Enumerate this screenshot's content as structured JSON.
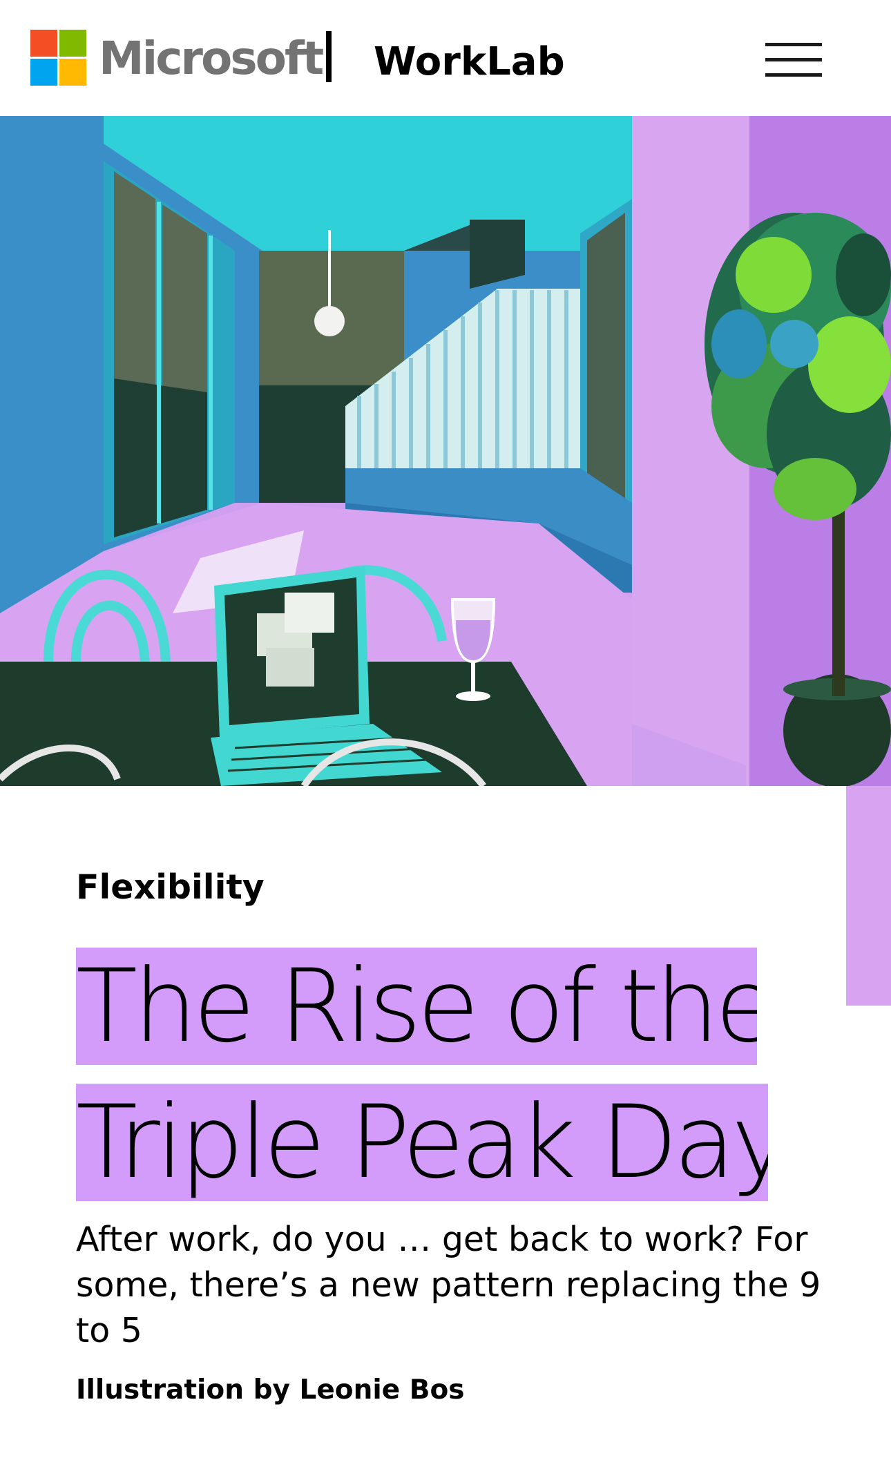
{
  "header": {
    "brand": "Microsoft",
    "site_name": "WorkLab",
    "logo_colors": [
      "#f25022",
      "#7fba00",
      "#00a4ef",
      "#ffb900"
    ],
    "menu_icon": "hamburger-menu-icon"
  },
  "hero": {
    "illustration": "home-office-illustration",
    "accent_color": "#d8a3f1"
  },
  "article": {
    "category": "Flexibility",
    "title_line1": "The Rise of the",
    "title_line2": "Triple Peak Day",
    "title_highlight_color": "#d39cfa",
    "subtitle": "After work, do you … get back to work? For some, there’s a new pattern replacing the 9 to 5",
    "credit": "Illustration by Leonie Bos"
  }
}
